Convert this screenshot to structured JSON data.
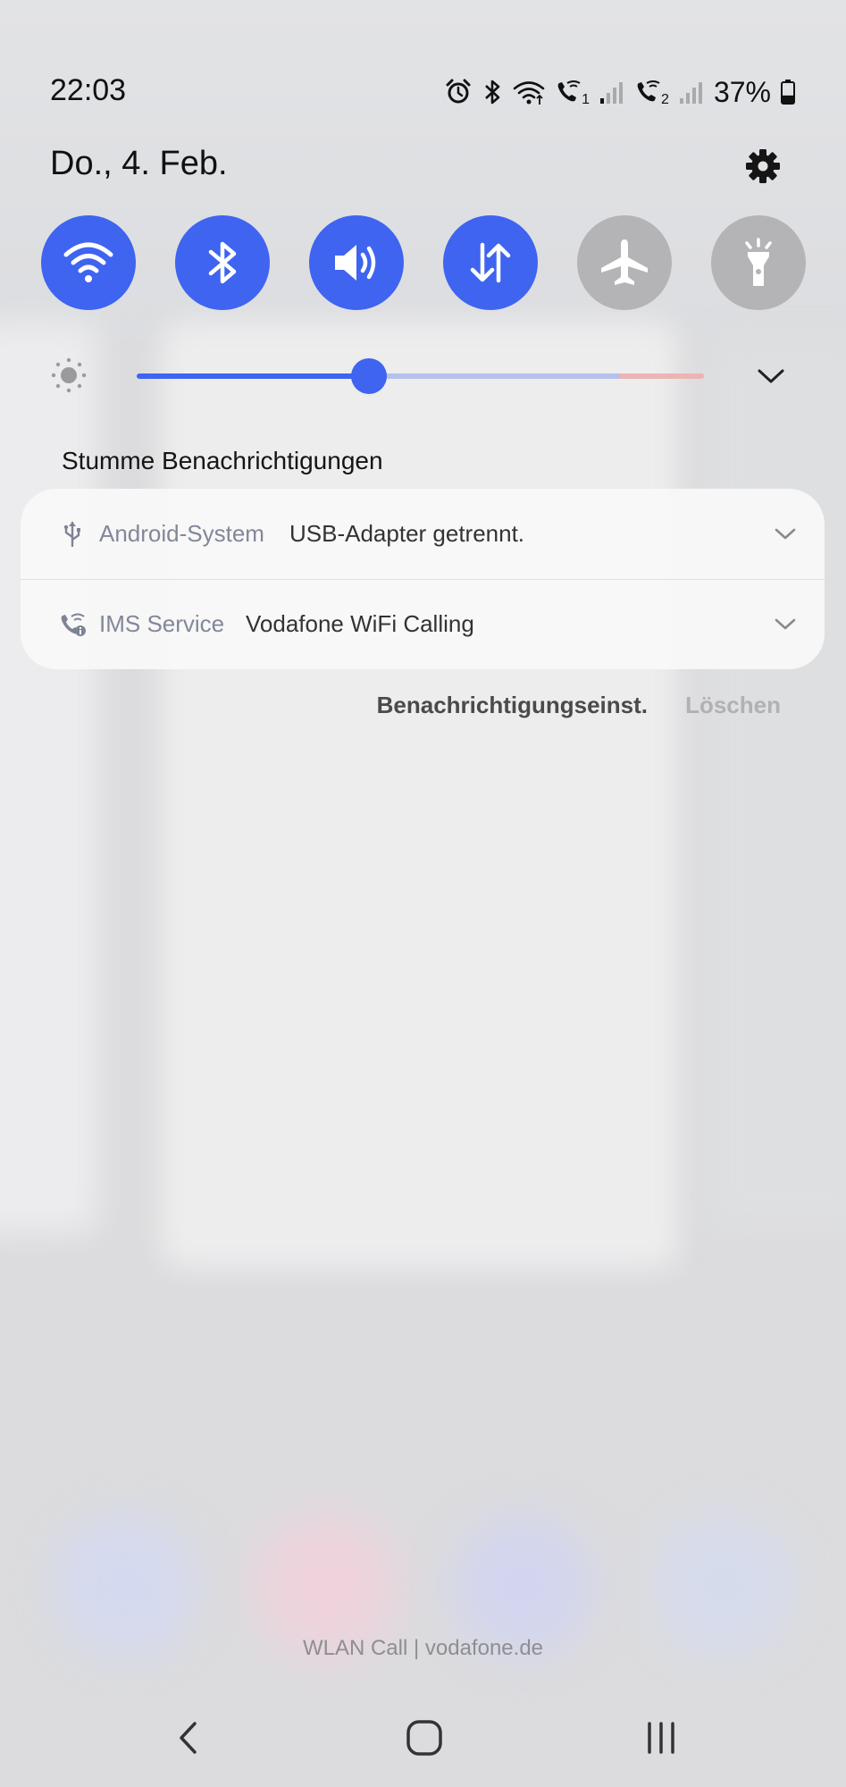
{
  "status_bar": {
    "time": "22:03",
    "battery": "37%",
    "icons": [
      "alarm-icon",
      "bluetooth-icon",
      "wifi-icon",
      "wifi-call-sim1-icon",
      "signal-sim1-icon",
      "wifi-call-sim2-icon",
      "signal-sim2-icon",
      "battery-icon"
    ],
    "sim_numbers": [
      "1",
      "2"
    ],
    "battery_level": 0.37
  },
  "header": {
    "date": "Do., 4. Feb.",
    "settings_icon": "gear-icon"
  },
  "quick_settings": [
    {
      "name": "wifi",
      "icon": "wifi-icon",
      "state": "on"
    },
    {
      "name": "bluetooth",
      "icon": "bluetooth-icon",
      "state": "on"
    },
    {
      "name": "sound",
      "icon": "speaker-icon",
      "state": "on"
    },
    {
      "name": "mobile-data",
      "icon": "data-arrows-icon",
      "state": "on"
    },
    {
      "name": "airplane-mode",
      "icon": "airplane-icon",
      "state": "off"
    },
    {
      "name": "flashlight",
      "icon": "flashlight-icon",
      "state": "off"
    }
  ],
  "brightness": {
    "level": 0.41,
    "warning_from": 0.85
  },
  "notifications": {
    "section_title": "Stumme Benachrichtigungen",
    "items": [
      {
        "app": "Android-System",
        "text": "USB-Adapter getrennt.",
        "icon": "usb-icon"
      },
      {
        "app": "IMS Service",
        "text": "Vodafone WiFi Calling",
        "icon": "wifi-call-icon"
      }
    ],
    "settings_label": "Benachrichtigungseinst.",
    "clear_label": "Löschen"
  },
  "carrier": "WLAN Call | vodafone.de",
  "nav": {
    "back_icon": "back-icon",
    "home_icon": "home-icon",
    "recents_icon": "recents-icon"
  },
  "colors": {
    "accent": "#3e64f0",
    "toggle_off": "#b4b4b6",
    "brightness_warning": "#ecb4b4"
  }
}
